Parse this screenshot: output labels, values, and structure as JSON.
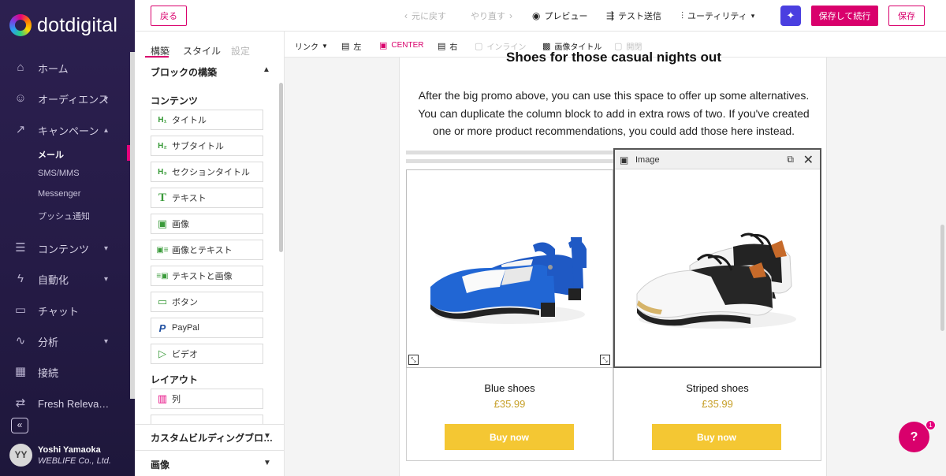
{
  "brand": {
    "name": "dotdigital",
    "accent": "#d9006c",
    "nav_bg": "#2c2050"
  },
  "nav": {
    "items": [
      {
        "label": "ホーム",
        "icon": "home-icon",
        "glyph": "⌂"
      },
      {
        "label": "オーディエンス",
        "icon": "audience-icon",
        "glyph": "☺"
      },
      {
        "label": "キャンペーン",
        "icon": "campaign-icon",
        "glyph": "↗"
      },
      {
        "label": "コンテンツ",
        "icon": "content-icon",
        "glyph": "☰"
      },
      {
        "label": "自動化",
        "icon": "automation-icon",
        "glyph": "ϟ"
      },
      {
        "label": "チャット",
        "icon": "chat-icon",
        "glyph": "▭"
      },
      {
        "label": "分析",
        "icon": "analytics-icon",
        "glyph": "∿"
      },
      {
        "label": "接続",
        "icon": "connect-icon",
        "glyph": "▦"
      },
      {
        "label": "Fresh Releva…",
        "icon": "fresh-relevance-icon",
        "glyph": "⇄"
      }
    ],
    "campaign_sub": [
      "メール",
      "SMS/MMS",
      "Messenger",
      "プッシュ通知"
    ],
    "user": {
      "initials": "YY",
      "name": "Yoshi Yamaoka",
      "company": "WEBLIFE Co., Ltd."
    }
  },
  "topbar": {
    "back": "戻る",
    "undo": "元に戻す",
    "redo": "やり直す",
    "preview": "プレビュー",
    "test_send": "テスト送信",
    "utility": "ユーティリティ",
    "save_continue": "保存して続行",
    "save": "保存"
  },
  "panel": {
    "tabs": [
      "構築",
      "スタイル",
      "設定"
    ],
    "section_title": "ブロックの構築",
    "content_heading": "コンテンツ",
    "blocks": [
      {
        "icon": "H₁",
        "label": "タイトル"
      },
      {
        "icon": "H₂",
        "label": "サブタイトル"
      },
      {
        "icon": "H₃",
        "label": "セクションタイトル"
      },
      {
        "icon": "T",
        "label": "テキスト"
      },
      {
        "icon": "▣",
        "label": "画像"
      },
      {
        "icon": "▣≡",
        "label": "画像とテキスト"
      },
      {
        "icon": "≡▣",
        "label": "テキストと画像"
      },
      {
        "icon": "▭",
        "label": "ボタン"
      },
      {
        "icon": "P",
        "label": "PayPal"
      },
      {
        "icon": "▷",
        "label": "ビデオ"
      }
    ],
    "layout_heading": "レイアウト",
    "layout_blocks": [
      {
        "icon": "▥",
        "label": "列"
      }
    ],
    "custom_section": "カスタムビルディングブロ…",
    "image_section": "画像"
  },
  "toolbar2": {
    "link": "リンク",
    "left": "左",
    "center": "CENTER",
    "right": "右",
    "inline": "インライン",
    "image_title": "画像タイトル",
    "open": "開閉"
  },
  "email": {
    "headline": "Shoes for those casual nights out",
    "paragraph": "After the big promo above, you can use this space to offer up some alternatives. You can duplicate the column block to add in extra rows of two. If you've created one or more product recommendations, you could add those here instead.",
    "products": [
      {
        "name": "Blue shoes",
        "price": "£35.99",
        "button": "Buy now"
      },
      {
        "name": "Striped shoes",
        "price": "£35.99",
        "button": "Buy now"
      }
    ],
    "image_toolbar_label": "Image"
  },
  "help": {
    "badge": "1",
    "label": "?"
  }
}
